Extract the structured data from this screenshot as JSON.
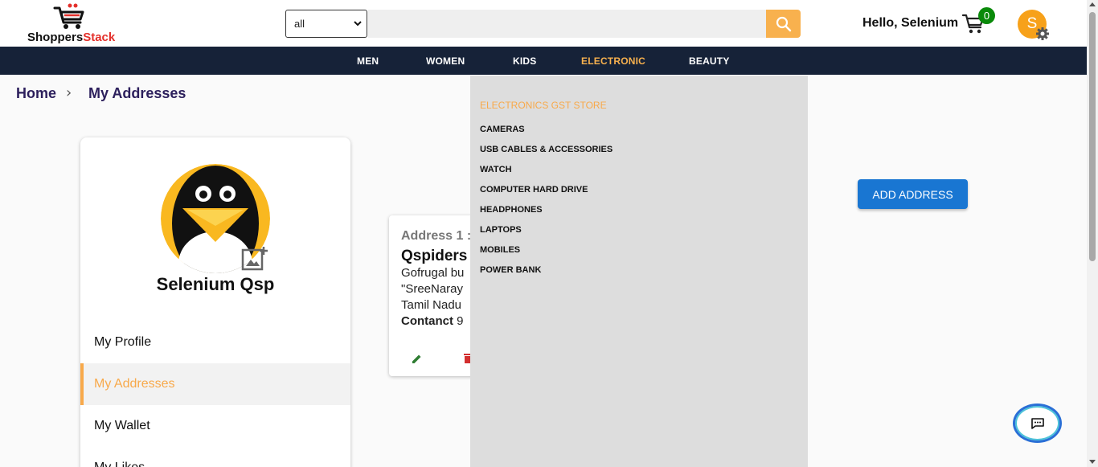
{
  "header": {
    "logo": {
      "part1": "Shoppers",
      "part2": "Stack"
    },
    "search": {
      "category": "all",
      "placeholder": ""
    },
    "greeting": "Hello, Selenium",
    "cart_count": "0",
    "avatar_initial": "S"
  },
  "nav": {
    "items": [
      {
        "label": "MEN"
      },
      {
        "label": "WOMEN"
      },
      {
        "label": "KIDS"
      },
      {
        "label": "ELECTRONIC",
        "active": true
      },
      {
        "label": "BEAUTY"
      }
    ]
  },
  "breadcrumb": {
    "home": "Home",
    "separator": "›",
    "current": "My Addresses"
  },
  "profile": {
    "name": "Selenium Qsp",
    "menu": [
      {
        "label": "My Profile"
      },
      {
        "label": "My Addresses",
        "active": true
      },
      {
        "label": "My Wallet"
      },
      {
        "label": "My Likes"
      }
    ]
  },
  "address": {
    "title": "Address 1 :",
    "name": "Qspiders",
    "line1": "Gofrugal bu",
    "line2": "\"SreeNaray",
    "line3": "Tamil Nadu",
    "contact_label": "Contanct",
    "contact_value": "9"
  },
  "dropdown": {
    "heading": "ELECTRONICS GST STORE",
    "items": [
      "CAMERAS",
      "USB CABLES & ACCESSORIES",
      "WATCH",
      "COMPUTER HARD DRIVE",
      "HEADPHONES",
      "LAPTOPS",
      "MOBILES",
      "POWER BANK"
    ]
  },
  "buttons": {
    "add_address": "ADD ADDRESS"
  },
  "colors": {
    "accent": "#f8b14e",
    "navbar": "#162238",
    "primary_button": "#1976d2",
    "cart_badge": "#0a8a0a",
    "avatar": "#f7a11a"
  },
  "icons": {
    "logo": "shopping-cart-logo-icon",
    "search": "search-icon",
    "cart": "cart-icon",
    "settings": "gear-icon",
    "add_photo": "add-photo-icon",
    "edit": "edit-icon",
    "delete": "delete-icon",
    "chat": "chat-icon"
  }
}
